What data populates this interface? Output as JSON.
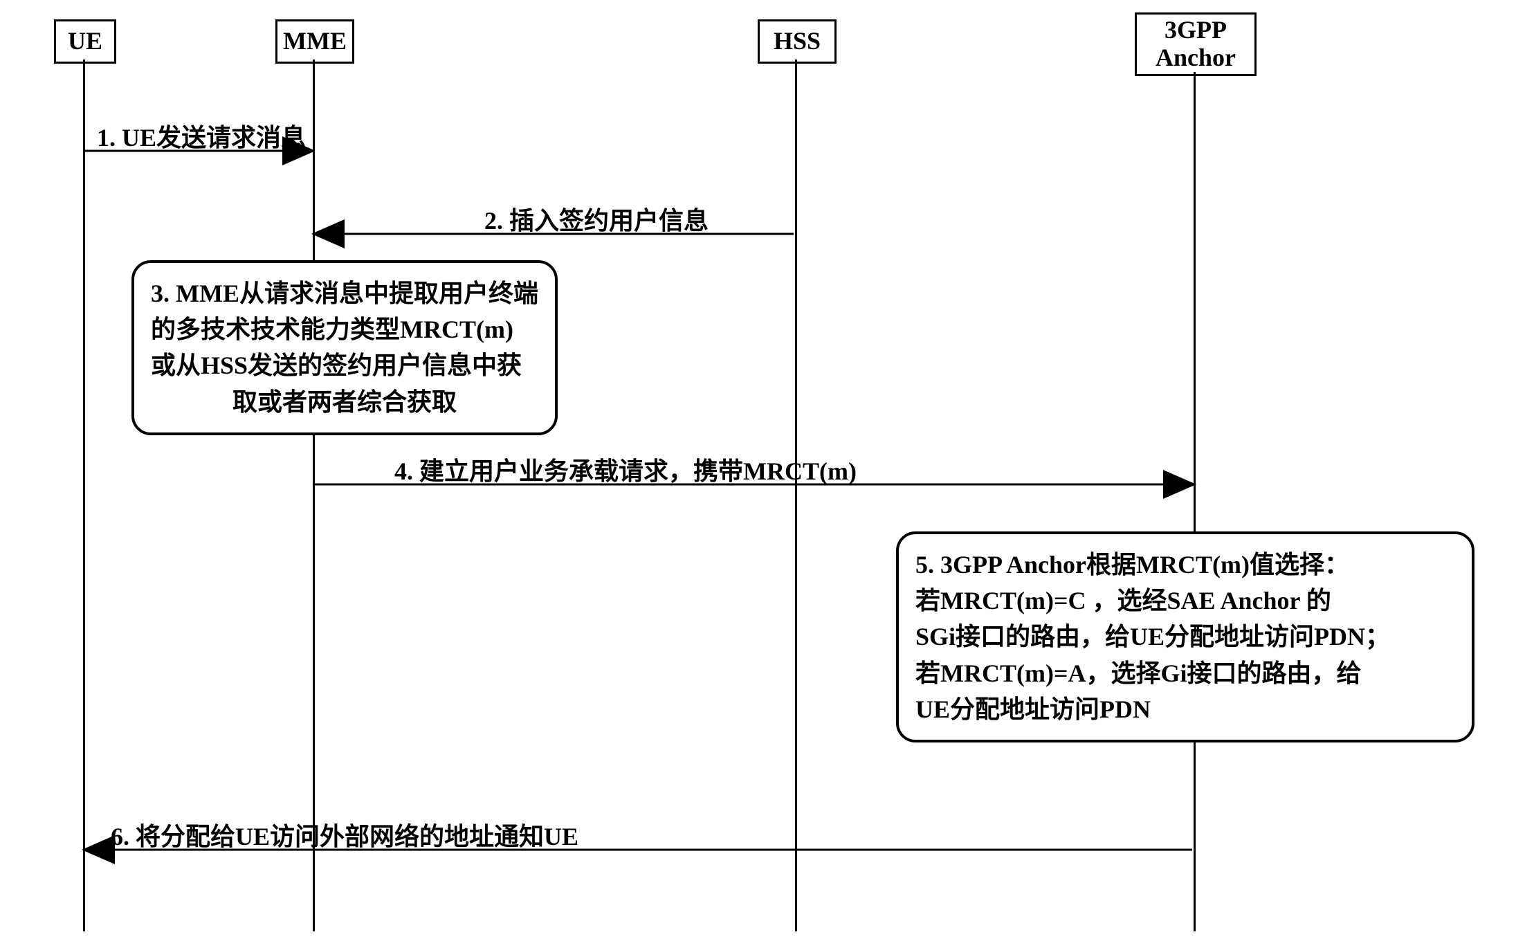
{
  "actors": {
    "ue": "UE",
    "mme": "MME",
    "hss": "HSS",
    "anchor_line1": "3GPP",
    "anchor_line2": "Anchor"
  },
  "messages": {
    "m1": "1. UE发送请求消息",
    "m2": "2. 插入签约用户信息",
    "m3_line1": "3. MME从请求消息中提取用户终端",
    "m3_line2": "的多技术技术能力类型MRCT(m)",
    "m3_line3": "或从HSS发送的签约用户信息中获",
    "m3_line4": "取或者两者综合获取",
    "m4": "4. 建立用户业务承载请求，携带MRCT(m)",
    "m5_line1": "5. 3GPP Anchor根据MRCT(m)值选择：",
    "m5_line2": "  若MRCT(m)=C ，选经SAE Anchor 的",
    "m5_line3": "SGi接口的路由，给UE分配地址访问PDN；",
    "m5_line4": "  若MRCT(m)=A，选择Gi接口的路由，给",
    "m5_line5": "UE分配地址访问PDN",
    "m6": "6. 将分配给UE访问外部网络的地址通知UE"
  },
  "chart_data": {
    "type": "sequence-diagram",
    "actors": [
      "UE",
      "MME",
      "HSS",
      "3GPP Anchor"
    ],
    "steps": [
      {
        "n": 1,
        "from": "UE",
        "to": "MME",
        "text": "UE发送请求消息"
      },
      {
        "n": 2,
        "from": "HSS",
        "to": "MME",
        "text": "插入签约用户信息"
      },
      {
        "n": 3,
        "at": "MME",
        "text": "MME从请求消息中提取用户终端的多技术技术能力类型MRCT(m)或从HSS发送的签约用户信息中获取或者两者综合获取"
      },
      {
        "n": 4,
        "from": "MME",
        "to": "3GPP Anchor",
        "text": "建立用户业务承载请求，携带MRCT(m)"
      },
      {
        "n": 5,
        "at": "3GPP Anchor",
        "text": "3GPP Anchor根据MRCT(m)值选择：若MRCT(m)=C ，选经SAE Anchor 的SGi接口的路由，给UE分配地址访问PDN；若MRCT(m)=A，选择Gi接口的路由，给UE分配地址访问PDN"
      },
      {
        "n": 6,
        "from": "3GPP Anchor",
        "to": "UE",
        "text": "将分配给UE访问外部网络的地址通知UE"
      }
    ]
  }
}
